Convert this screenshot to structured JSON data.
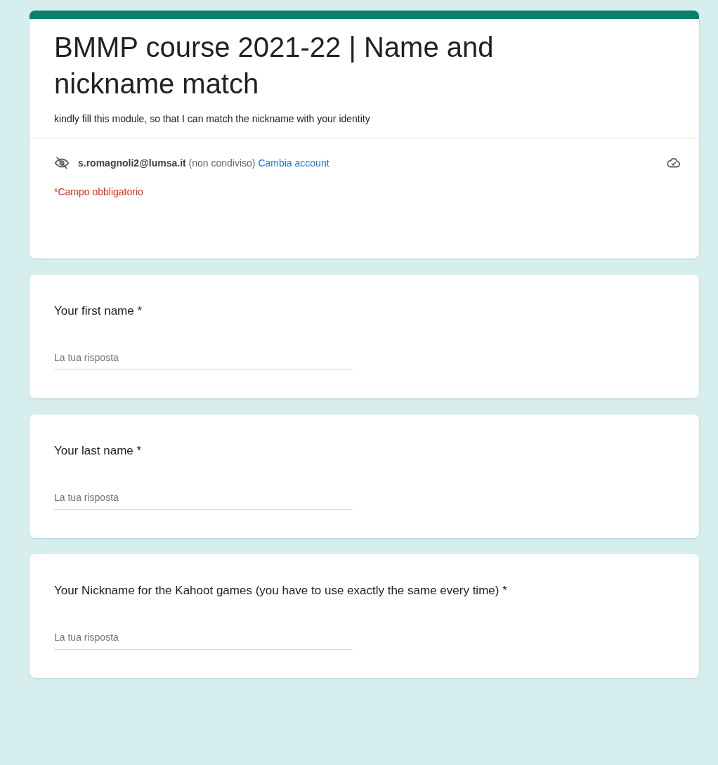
{
  "header": {
    "title": "BMMP course 2021-22 | Name and nickname match",
    "description": "kindly fill this module, so that I can match the nickname with your identity",
    "account": {
      "email": "s.romagnoli2@lumsa.it",
      "sharing": "(non condiviso)",
      "switch_link": "Cambia account"
    },
    "required_note": "*Campo obbligatorio"
  },
  "questions": [
    {
      "label": "Your first name *",
      "placeholder": "La tua risposta"
    },
    {
      "label": "Your last name *",
      "placeholder": "La tua risposta"
    },
    {
      "label": "Your Nickname for the Kahoot games (you have to use exactly the same every time) *",
      "placeholder": "La tua risposta"
    }
  ]
}
